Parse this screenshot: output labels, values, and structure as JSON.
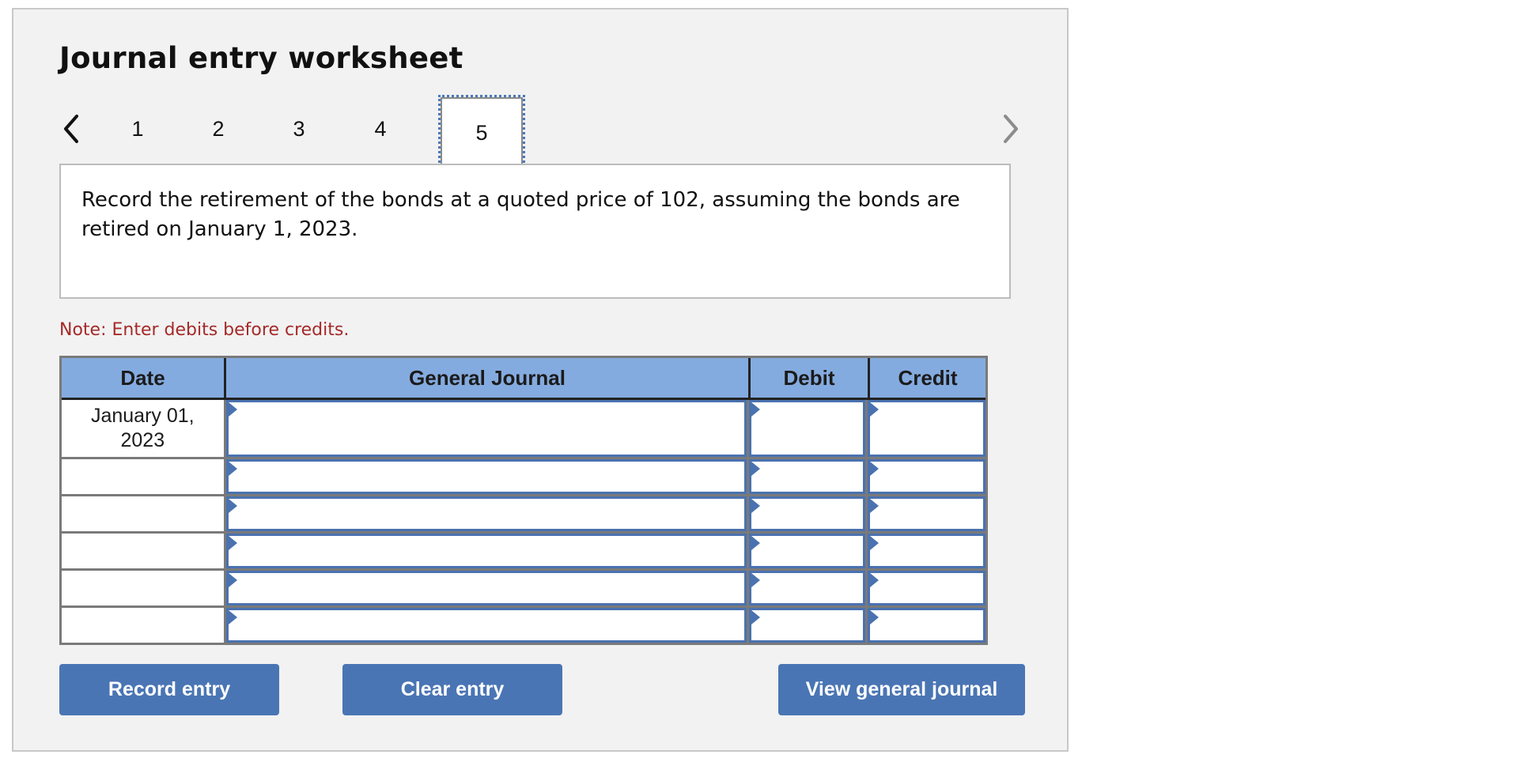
{
  "worksheet": {
    "title": "Journal entry worksheet",
    "nav": {
      "prev_icon": "chevron-left-icon",
      "next_icon": "chevron-right-icon",
      "steps": [
        "1",
        "2",
        "3",
        "4",
        "5"
      ],
      "active_step": "5"
    },
    "question": "Record the retirement of the bonds at a quoted price of 102, assuming the bonds are retired on January 1, 2023.",
    "note": "Note: Enter debits before credits.",
    "table": {
      "headers": {
        "date": "Date",
        "general_journal": "General Journal",
        "debit": "Debit",
        "credit": "Credit"
      },
      "rows": [
        {
          "date": "January 01, 2023",
          "account": "",
          "debit": "",
          "credit": ""
        },
        {
          "date": "",
          "account": "",
          "debit": "",
          "credit": ""
        },
        {
          "date": "",
          "account": "",
          "debit": "",
          "credit": ""
        },
        {
          "date": "",
          "account": "",
          "debit": "",
          "credit": ""
        },
        {
          "date": "",
          "account": "",
          "debit": "",
          "credit": ""
        },
        {
          "date": "",
          "account": "",
          "debit": "",
          "credit": ""
        }
      ]
    },
    "buttons": {
      "record": "Record entry",
      "clear": "Clear entry",
      "view": "View general journal"
    },
    "colors": {
      "header_bg": "#84abdf",
      "button_bg": "#4a75b4",
      "input_border": "#4a72b0",
      "note_text": "#a52a2a",
      "focus_outline": "#4a78b8"
    }
  }
}
